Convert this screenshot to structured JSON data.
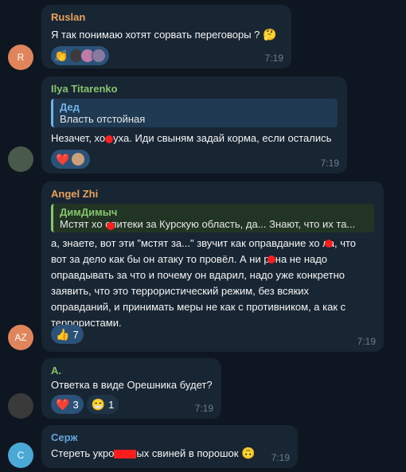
{
  "messages": [
    {
      "author": "Ruslan",
      "author_color": "#e8a35b",
      "avatar_initial": "R",
      "avatar_color": "#e0855b",
      "text": "Я так понимаю хотят сорвать переговоры ?",
      "emoji": "🤔",
      "reactions": [
        "👏",
        "avatar",
        "avatar",
        "avatar"
      ],
      "time": "7:19"
    },
    {
      "author": "Ilya Titarenko",
      "author_color": "#87c46e",
      "quote_author": "Дед",
      "quote_text": "Власть отстойная",
      "text_before": "Незачет, хо",
      "text_after": "уха. Иди свыням задай корма, если остались",
      "reactions": [
        "❤️",
        "avatar"
      ],
      "time": "7:19"
    },
    {
      "author": "Angel Zhi",
      "author_color": "#e8a35b",
      "avatar_initial": "AZ",
      "avatar_color": "#e0855b",
      "quote_author": "ДимДимыч",
      "quote_text": "Мстят хо   опитеки за Курскую область, да... Знают, что их та...",
      "text_lines": [
        "а, знаете, вот эти \"мстят за...\" звучит как оправдание хо   ла, что",
        "вот за дело как бы он атаку то провёл. А ни   рена не надо",
        "оправдывать за что и почему он вдарил, надо уже конкретно",
        "заявить, что это террористический режим, без всяких",
        "оправданий, и принимать меры не как с противником, а как с",
        "террористами."
      ],
      "reaction_emoji": "👍",
      "reaction_count": "7",
      "time": "7:19"
    },
    {
      "author": "A.",
      "author_color": "#87c46e",
      "text": "Ответка в виде Орешника будет?",
      "reactions": [
        {
          "emoji": "❤️",
          "count": "3"
        },
        {
          "emoji": "😁",
          "count": "1"
        }
      ],
      "time": "7:19"
    },
    {
      "author": "Серж",
      "author_color": "#5fa6d8",
      "avatar_initial": "С",
      "avatar_color": "#4aa9d6",
      "text_before": "Стереть укро",
      "text_after": "ых свиней в порошок",
      "emoji": "🙃",
      "time": "7:19"
    }
  ]
}
